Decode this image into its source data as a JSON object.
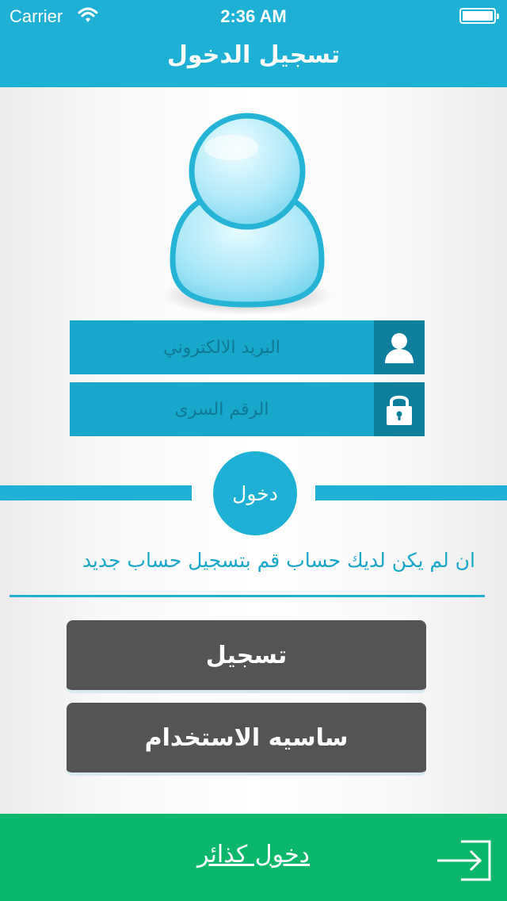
{
  "status_bar": {
    "carrier": "Carrier",
    "time": "2:36 AM",
    "battery_percent": 100
  },
  "header": {
    "title": "تسجيل الدخول"
  },
  "form": {
    "email_placeholder": "البريد الالكتروني",
    "email_value": "",
    "password_placeholder": "الرقم السرى",
    "password_value": ""
  },
  "login_button": {
    "label": "دخول"
  },
  "register_hint": "ان لم يكن لديك حساب قم بتسجيل حساب جديد",
  "buttons": {
    "register": "تسجيل",
    "policy": "ساسيه الاستخدام"
  },
  "footer": {
    "guest_login": "دخول كذائر"
  },
  "icons": {
    "avatar": "user-avatar-icon",
    "email": "user-icon",
    "password": "lock-icon",
    "guest": "enter-arrow-icon",
    "wifi": "wifi-icon",
    "battery": "battery-icon"
  },
  "colors": {
    "primary": "#1fb1d5",
    "field": "#17a7cb",
    "field_icon_bg": "#0d7f9c",
    "button_dark": "#545454",
    "footer": "#0bb76a"
  }
}
